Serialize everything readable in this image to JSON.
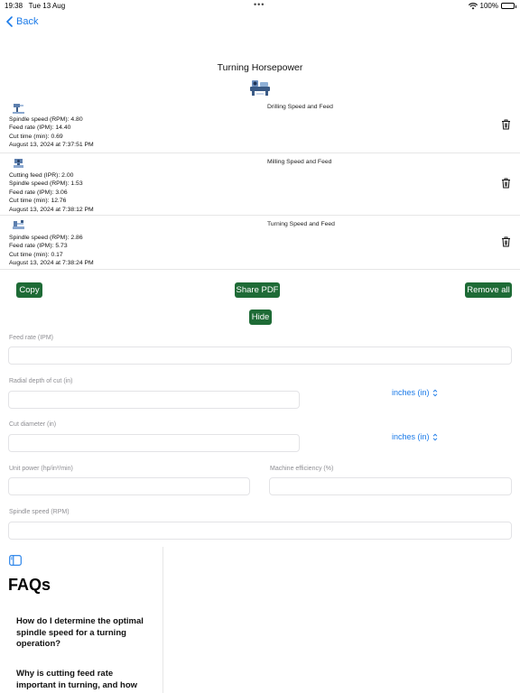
{
  "status_bar": {
    "time": "19:38",
    "date": "Tue 13 Aug",
    "battery": "100%"
  },
  "nav": {
    "back_label": "Back"
  },
  "page": {
    "title": "Turning Horsepower"
  },
  "history": [
    {
      "title": "Drilling Speed and Feed",
      "lines": [
        "Spindle speed (RPM): 4.80",
        "Feed rate (IPM): 14.40",
        "Cut time (min): 0.69",
        "August 13, 2024 at 7:37:51 PM"
      ]
    },
    {
      "title": "Milling Speed and Feed",
      "lines": [
        "Cutting feed (IPR): 2.00",
        "Spindle speed (RPM): 1.53",
        "Feed rate (IPM): 3.06",
        "Cut time (min): 12.76",
        "August 13, 2024 at 7:38:12 PM"
      ]
    },
    {
      "title": "Turning Speed and Feed",
      "lines": [
        "Spindle speed (RPM): 2.86",
        "Feed rate (IPM): 5.73",
        "Cut time (min): 0.17",
        "August 13, 2024 at 7:38:24 PM"
      ]
    }
  ],
  "actions": {
    "copy_label": "Copy",
    "share_label": "Share PDF",
    "remove_label": "Remove all",
    "hide_label": "Hide"
  },
  "form": {
    "feed_rate_label": "Feed rate (IPM)",
    "radial_depth_label": "Radial depth of cut (in)",
    "radial_depth_unit": "inches (in)",
    "cut_diameter_label": "Cut diameter (in)",
    "cut_diameter_unit": "inches (in)",
    "unit_power_label": "Unit power (hp/in³/min)",
    "machine_efficiency_label": "Machine efficiency (%)",
    "spindle_speed_label": "Spindle speed (RPM)"
  },
  "faq": {
    "heading": "FAQs",
    "questions": [
      "How do I determine the optimal spindle speed for a turning operation?",
      "Why is cutting feed rate important in turning, and how"
    ]
  },
  "colors": {
    "accent": "#1a7ae8",
    "button_green": "#1e6b36"
  }
}
